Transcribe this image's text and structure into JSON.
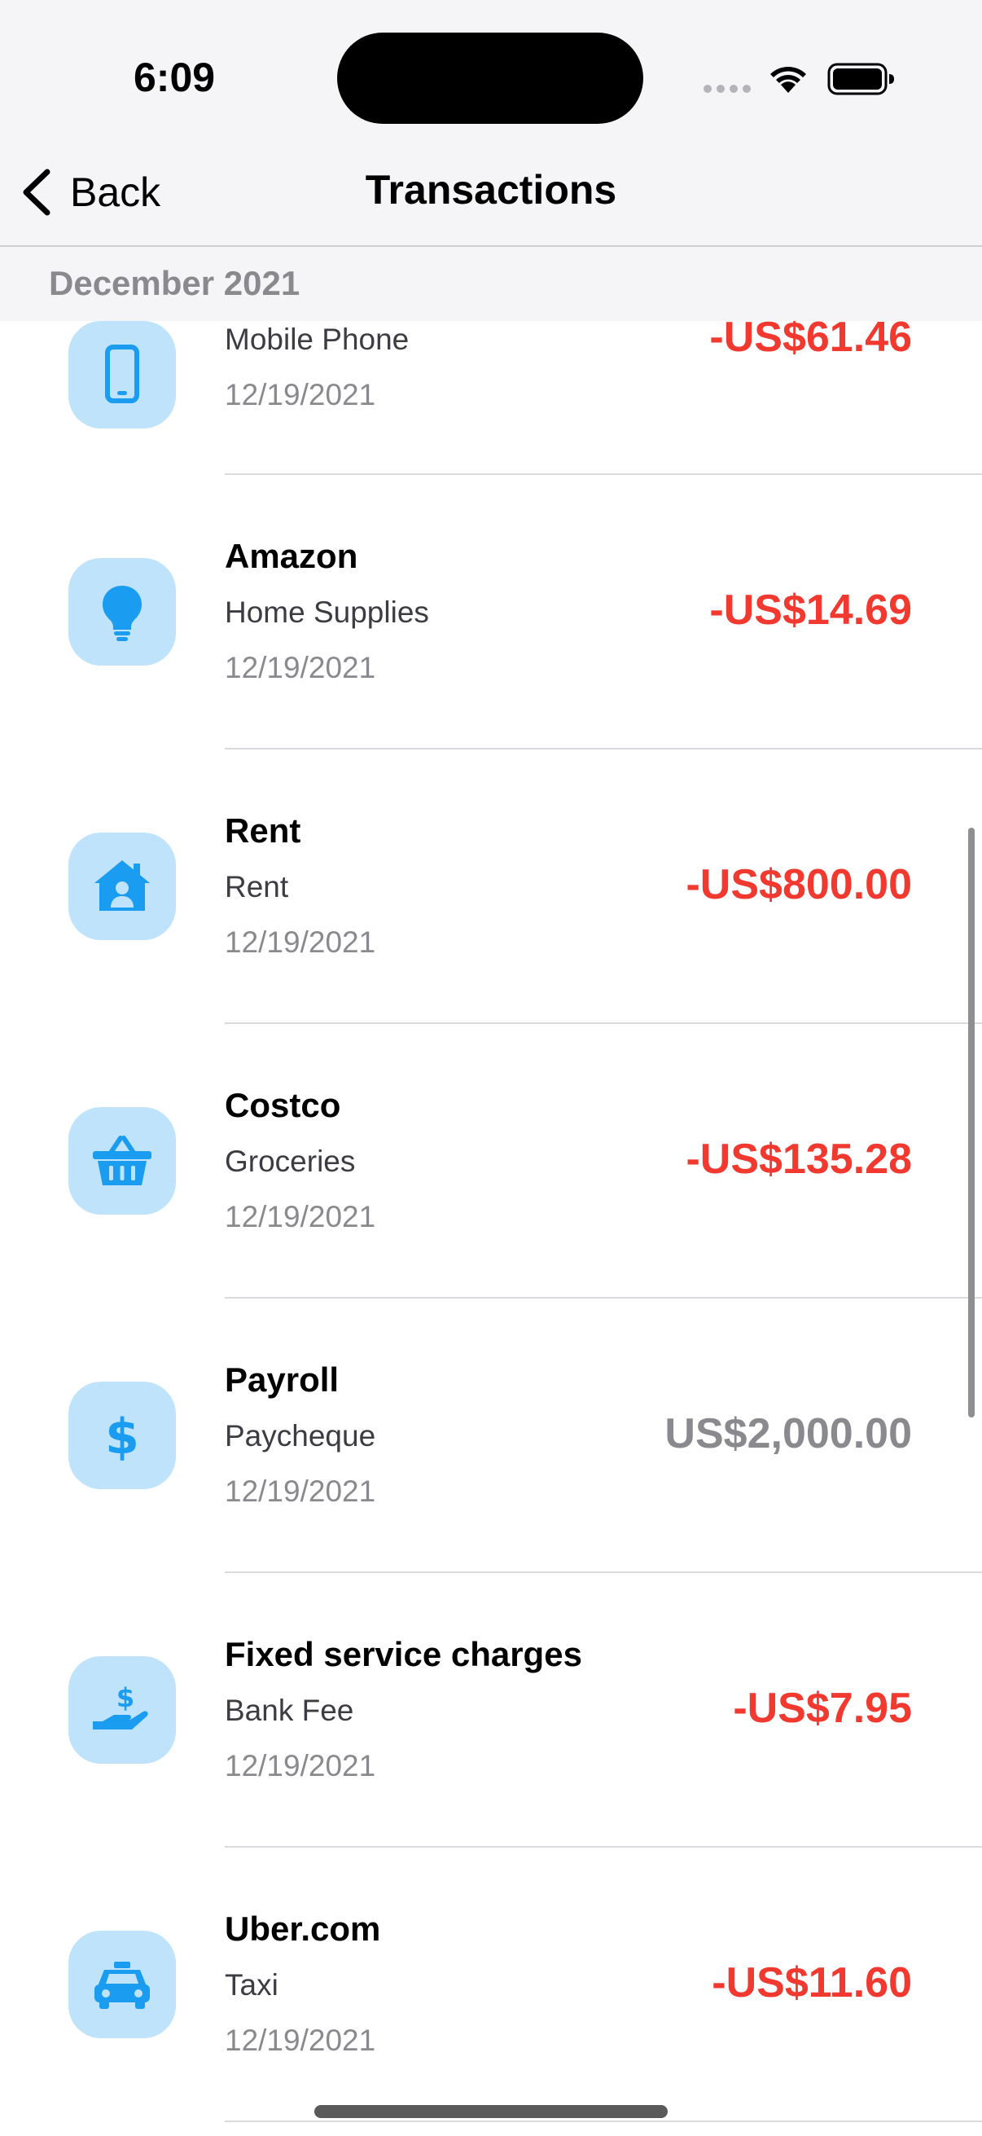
{
  "status_bar": {
    "time": "6:09"
  },
  "nav": {
    "back_label": "Back",
    "title": "Transactions"
  },
  "section": {
    "header": "December 2021"
  },
  "colors": {
    "expense": "#f2392f",
    "income": "#8a8a8e",
    "icon_tile": "#bfe3fb",
    "icon": "#1a9cf0"
  },
  "transactions": [
    {
      "name": "",
      "category": "Mobile Phone",
      "date": "12/19/2021",
      "amount": "-US$61.46",
      "type": "expense",
      "icon": "mobile-phone-icon"
    },
    {
      "name": "Amazon",
      "category": "Home Supplies",
      "date": "12/19/2021",
      "amount": "-US$14.69",
      "type": "expense",
      "icon": "lightbulb-icon"
    },
    {
      "name": "Rent",
      "category": "Rent",
      "date": "12/19/2021",
      "amount": "-US$800.00",
      "type": "expense",
      "icon": "house-icon"
    },
    {
      "name": "Costco",
      "category": "Groceries",
      "date": "12/19/2021",
      "amount": "-US$135.28",
      "type": "expense",
      "icon": "basket-icon"
    },
    {
      "name": "Payroll",
      "category": "Paycheque",
      "date": "12/19/2021",
      "amount": "US$2,000.00",
      "type": "income",
      "icon": "dollar-sign-icon"
    },
    {
      "name": "Fixed service charges",
      "category": "Bank Fee",
      "date": "12/19/2021",
      "amount": "-US$7.95",
      "type": "expense",
      "icon": "hand-dollar-icon"
    },
    {
      "name": "Uber.com",
      "category": "Taxi",
      "date": "12/19/2021",
      "amount": "-US$11.60",
      "type": "expense",
      "icon": "taxi-icon"
    }
  ]
}
